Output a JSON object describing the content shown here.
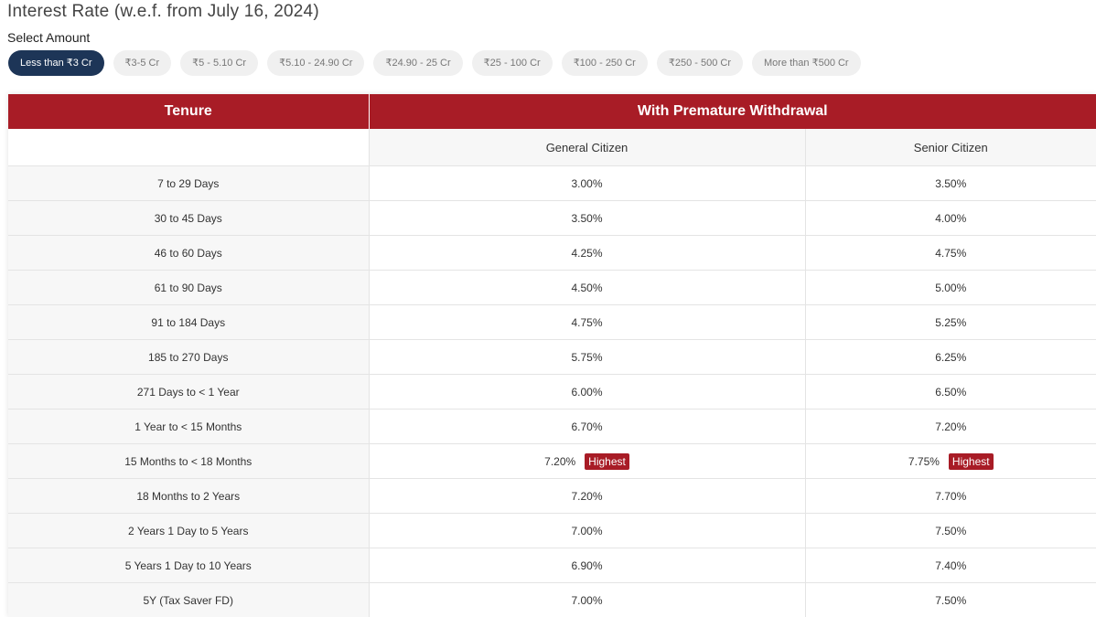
{
  "page": {
    "title": "Interest Rate (w.e.f. from July 16, 2024)",
    "select_label": "Select Amount"
  },
  "amount_chips": [
    {
      "label": "Less than ₹3 Cr",
      "active": true
    },
    {
      "label": "₹3-5 Cr",
      "active": false
    },
    {
      "label": "₹5 - 5.10 Cr",
      "active": false
    },
    {
      "label": "₹5.10 - 24.90 Cr",
      "active": false
    },
    {
      "label": "₹24.90 - 25 Cr",
      "active": false
    },
    {
      "label": "₹25 - 100 Cr",
      "active": false
    },
    {
      "label": "₹100 - 250 Cr",
      "active": false
    },
    {
      "label": "₹250 - 500 Cr",
      "active": false
    },
    {
      "label": "More than ₹500 Cr",
      "active": false
    }
  ],
  "table": {
    "headers": {
      "tenure": "Tenure",
      "group": "With Premature Withdrawal",
      "general": "General Citizen",
      "senior": "Senior Citizen"
    },
    "badge_label": "Highest",
    "rows": [
      {
        "tenure": "7 to 29 Days",
        "general": "3.00%",
        "senior": "3.50%",
        "highest": false
      },
      {
        "tenure": "30 to 45 Days",
        "general": "3.50%",
        "senior": "4.00%",
        "highest": false
      },
      {
        "tenure": "46 to 60 Days",
        "general": "4.25%",
        "senior": "4.75%",
        "highest": false
      },
      {
        "tenure": "61 to 90 Days",
        "general": "4.50%",
        "senior": "5.00%",
        "highest": false
      },
      {
        "tenure": "91 to 184 Days",
        "general": "4.75%",
        "senior": "5.25%",
        "highest": false
      },
      {
        "tenure": "185 to 270 Days",
        "general": "5.75%",
        "senior": "6.25%",
        "highest": false
      },
      {
        "tenure": "271 Days to < 1 Year",
        "general": "6.00%",
        "senior": "6.50%",
        "highest": false
      },
      {
        "tenure": "1 Year to < 15 Months",
        "general": "6.70%",
        "senior": "7.20%",
        "highest": false
      },
      {
        "tenure": "15 Months to < 18 Months",
        "general": "7.20%",
        "senior": "7.75%",
        "highest": true
      },
      {
        "tenure": "18 Months to 2 Years",
        "general": "7.20%",
        "senior": "7.70%",
        "highest": false
      },
      {
        "tenure": "2 Years 1 Day to 5 Years",
        "general": "7.00%",
        "senior": "7.50%",
        "highest": false
      },
      {
        "tenure": "5 Years 1 Day to 10 Years",
        "general": "6.90%",
        "senior": "7.40%",
        "highest": false
      },
      {
        "tenure": "5Y (Tax Saver FD)",
        "general": "7.00%",
        "senior": "7.50%",
        "highest": false
      }
    ]
  },
  "colors": {
    "header_red": "#a81c26",
    "active_chip": "#1d3557",
    "chip_bg": "#f0f0f0"
  }
}
